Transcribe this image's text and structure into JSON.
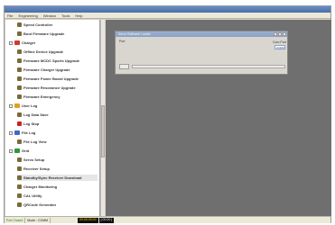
{
  "menu": [
    "File",
    "Engineering",
    "Window",
    "Tools",
    "Help"
  ],
  "tree": [
    {
      "label": "Speed Controller",
      "icon": "leaf-icon",
      "level": 2
    },
    {
      "label": "Boot Firmware Upgrade",
      "icon": "leaf-icon",
      "level": 2
    },
    {
      "label": "Charger",
      "icon": "charger-icon",
      "level": 1,
      "color": "#d23a2a"
    },
    {
      "label": "Offline Device Upgrade",
      "icon": "leaf-icon",
      "level": 2
    },
    {
      "label": "Firmware MCDC Sports Upgrade",
      "icon": "leaf-icon",
      "level": 2
    },
    {
      "label": "Firmware Charger Upgrade",
      "icon": "leaf-icon",
      "level": 2
    },
    {
      "label": "Firmware Power Board Upgrade",
      "icon": "leaf-icon",
      "level": 2
    },
    {
      "label": "Firmware Resonance Upgrade",
      "icon": "leaf-icon",
      "level": 2
    },
    {
      "label": "Firmware Emergency",
      "icon": "leaf-icon",
      "level": 2
    },
    {
      "label": "User Log",
      "icon": "log-icon",
      "level": 1,
      "color": "#e0a020"
    },
    {
      "label": "Log Data Save",
      "icon": "leaf-icon",
      "level": 2
    },
    {
      "label": "Log Stop",
      "icon": "stop-icon",
      "level": 2,
      "color": "#cc2222"
    },
    {
      "label": "File Log",
      "icon": "file-log-icon",
      "level": 1,
      "color": "#3a6ac8"
    },
    {
      "label": "File Log View",
      "icon": "leaf-icon",
      "level": 2
    },
    {
      "label": "Grid",
      "icon": "grid-icon",
      "level": 1,
      "color": "#2a9a3a"
    },
    {
      "label": "Servo Setup",
      "icon": "leaf-icon",
      "level": 2
    },
    {
      "label": "Receiver Setup",
      "icon": "leaf-icon",
      "level": 2
    },
    {
      "label": "Standby/Sync Receiver Download",
      "icon": "leaf-icon",
      "level": 2,
      "selected": true
    },
    {
      "label": "Charger Monitoring",
      "icon": "leaf-icon",
      "level": 2
    },
    {
      "label": "CAL Utility",
      "icon": "leaf-icon",
      "level": 2
    },
    {
      "label": "QRCode Generator",
      "icon": "leaf-icon",
      "level": 2
    }
  ],
  "dialog": {
    "title": "Servo Software Loader",
    "field_label": "Port",
    "port_label": "Com Port",
    "port_value": "COM3",
    "progress": 0.0
  },
  "status": {
    "state": "Port Closed",
    "mode": "Mode : COMM",
    "black_left": "00:00:00:00",
    "black_right": "[ 00.00 ]"
  },
  "colors": {
    "mdi_bg": "#6f6f6f",
    "tree_bg": "#ffffff",
    "accent": "#7fa0d8"
  }
}
